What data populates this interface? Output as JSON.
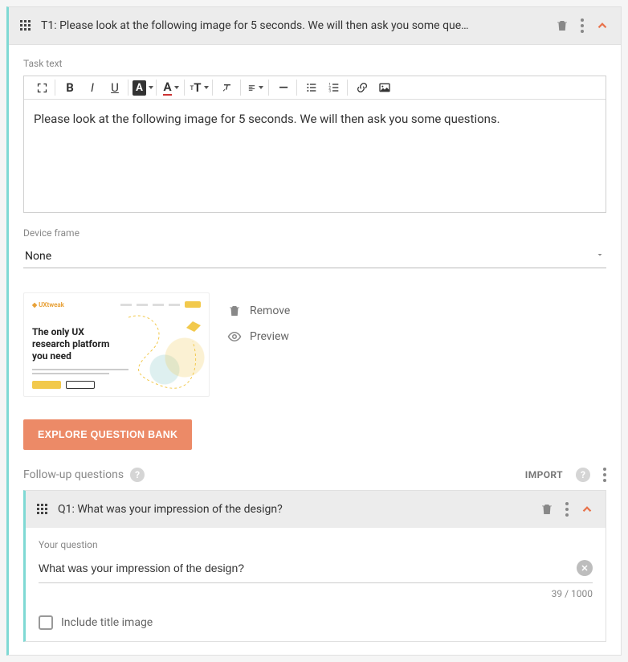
{
  "task": {
    "title": "T1: Please look at the following image for 5 seconds. We will then ask you some que…",
    "label_task_text": "Task text",
    "content": "Please look at the following image for 5 seconds. We will then ask you some questions.",
    "device_frame_label": "Device frame",
    "device_frame_value": "None",
    "thumb": {
      "brand": "UXtweak",
      "headline1": "The only UX",
      "headline2": "research platform",
      "headline3": "you need"
    },
    "thumb_actions": {
      "remove": "Remove",
      "preview": "Preview"
    },
    "explore_button": "EXPLORE QUESTION BANK",
    "followup_label": "Follow-up questions",
    "import_label": "IMPORT"
  },
  "question": {
    "title": "Q1: What was your impression of the design?",
    "your_question_label": "Your question",
    "value": "What was your impression of the design?",
    "counter": "39 / 1000",
    "include_title_image": "Include title image"
  },
  "toolbar": {
    "fullscreen": "fullscreen",
    "bold": "B",
    "italic": "I",
    "underline": "U",
    "bgcolor": "A",
    "textcolor": "A",
    "fontsize": "tT",
    "clearfmt": "clear",
    "align": "align",
    "hr": "—",
    "ul": "ul",
    "ol": "ol",
    "link": "link",
    "image": "image"
  }
}
